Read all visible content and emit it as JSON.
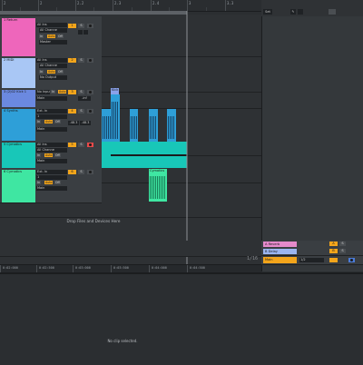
{
  "ruler": {
    "bars": [
      "2",
      "2.2",
      "2.3",
      "2.4",
      "3",
      "3.2",
      "3.3"
    ]
  },
  "arrangement": {
    "drop_message": "Drop Files and Devices Here",
    "zoom": "1/16",
    "clips": {
      "kick_label": "Kick",
      "synth_label": "Synth",
      "cymatics_label": "Cymatics"
    }
  },
  "time_ruler": [
    "0:02:000",
    "0:02:500",
    "0:03:000",
    "0:03:500",
    "0:04:000",
    "0:04:500"
  ],
  "top_controls": {
    "set": "Set",
    "edit": "✎"
  },
  "tracks": [
    {
      "name": "1 Return",
      "color": "#ee66bb",
      "input": "All Ins",
      "channel": "All Channe",
      "monitor": [
        "In",
        "Auto",
        "Off"
      ],
      "output": "Master",
      "num": "1",
      "solo": "S"
    },
    {
      "name": "2 MIDI",
      "color": "#a9c7f5",
      "input": "All Ins",
      "channel": "All Channe",
      "monitor": [
        "In",
        "Auto",
        "Off"
      ],
      "output": "No Output",
      "num": "2",
      "solo": "S"
    },
    {
      "name": "3 (2)02 Kick 1",
      "color": "#6b89e0",
      "input": "No Input",
      "monitor": [
        "In",
        "Auto",
        "Off"
      ],
      "output": "Main",
      "num": "3",
      "solo": "S",
      "vol": "-inf"
    },
    {
      "name": "4 Synths",
      "color": "#2e9fd8",
      "input": "Ext. In",
      "channel": "1",
      "monitor": [
        "In",
        "Auto",
        "Off"
      ],
      "output": "Main",
      "num": "4",
      "solo": "S",
      "vol": "-48.3",
      "vol2": "-48.3"
    },
    {
      "name": "5 Cymatics",
      "color": "#18c7b8",
      "input": "All Ins",
      "channel": "All Channe",
      "monitor": [
        "In",
        "Auto",
        "Off"
      ],
      "output": "Main",
      "num": "5",
      "solo": "S"
    },
    {
      "name": "6 Cymatics",
      "color": "#3fe6a2",
      "input": "Ext. In",
      "channel": "1",
      "monitor": [
        "In",
        "Auto",
        "Off"
      ],
      "output": "Main",
      "num": "6",
      "solo": "S"
    }
  ],
  "returns": [
    {
      "name": "A Reverb",
      "color": "#e58acb",
      "letter": "A",
      "solo": "S"
    },
    {
      "name": "B Delay",
      "color": "#9bb5f0",
      "letter": "B",
      "solo": "S"
    },
    {
      "name": "Main",
      "color": "#f3a51b",
      "fraction": "1/2",
      "solo": "S"
    }
  ],
  "detail": {
    "message": "No clip selected."
  }
}
